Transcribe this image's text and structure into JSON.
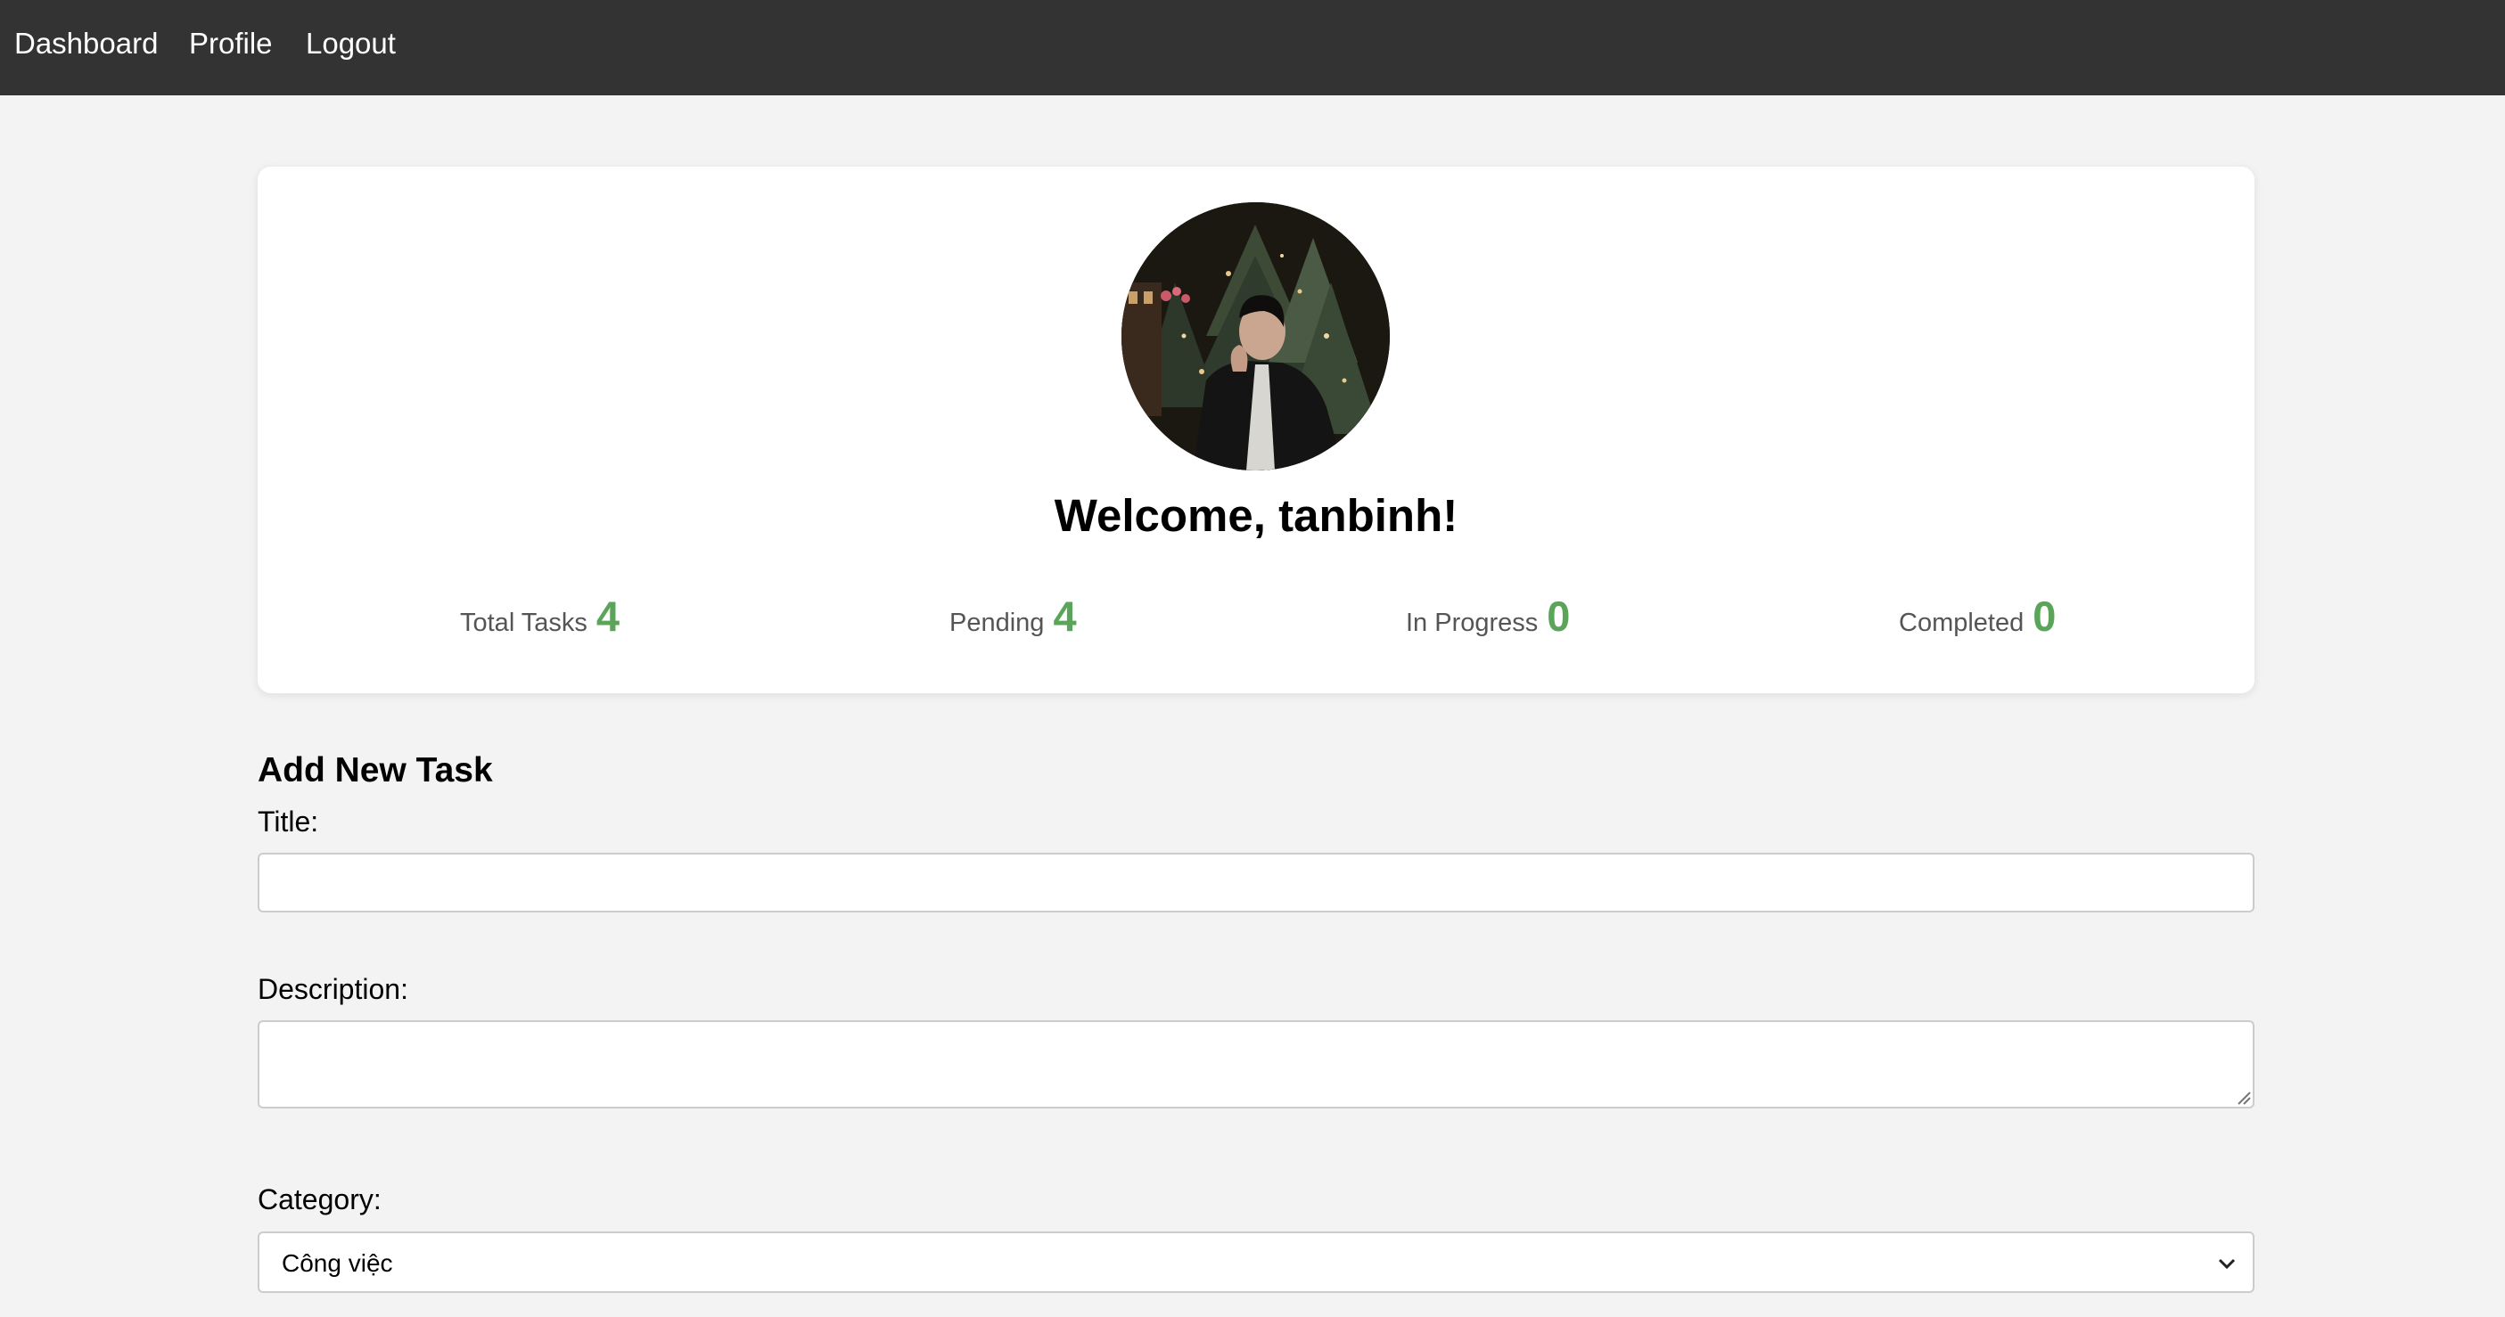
{
  "nav": {
    "items": [
      {
        "label": "Dashboard"
      },
      {
        "label": "Profile"
      },
      {
        "label": "Logout"
      }
    ]
  },
  "profile": {
    "avatar_icon": "user-photo-avatar",
    "welcome": "Welcome, tanbinh!"
  },
  "stats": {
    "total_label": "Total Tasks",
    "total_value": "4",
    "pending_label": "Pending",
    "pending_value": "4",
    "in_progress_label": "In Progress",
    "in_progress_value": "0",
    "completed_label": "Completed",
    "completed_value": "0"
  },
  "form": {
    "heading": "Add New Task",
    "title_label": "Title:",
    "title_value": "",
    "description_label": "Description:",
    "description_value": "",
    "category_label": "Category:",
    "category_selected": "Công việc"
  },
  "colors": {
    "navbar_bg": "#333333",
    "page_bg": "#f3f3f3",
    "stat_value": "#5aa55a",
    "stat_label": "#555555"
  }
}
